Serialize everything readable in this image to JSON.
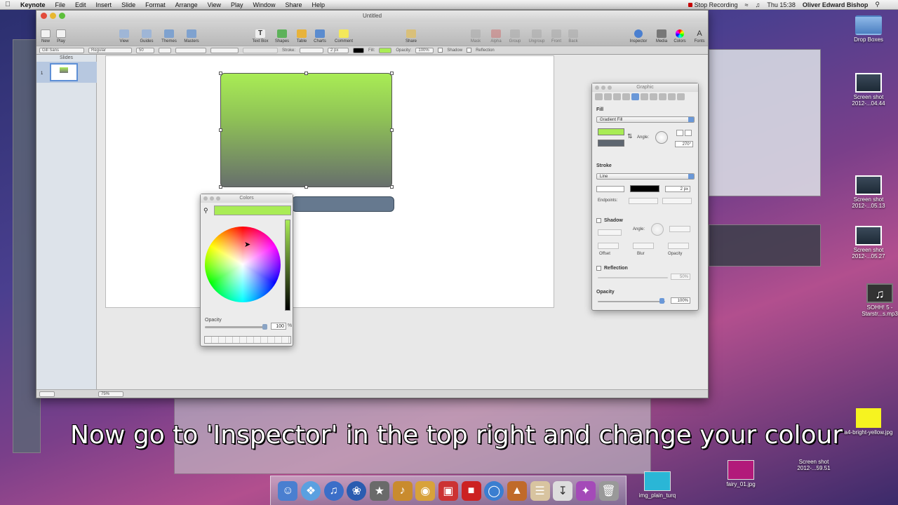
{
  "menubar": {
    "app": "Keynote",
    "menus": [
      "File",
      "Edit",
      "Insert",
      "Slide",
      "Format",
      "Arrange",
      "View",
      "Play",
      "Window",
      "Share",
      "Help"
    ],
    "recording": "Stop Recording",
    "clock": "Thu 15:38",
    "user": "Oliver Edward Bishop"
  },
  "window": {
    "title": "Untitled",
    "toolbar": {
      "left": [
        "New",
        "Play"
      ],
      "middle_left": [
        "View",
        "Guides",
        "Themes",
        "Masters"
      ],
      "middle": [
        "Text Box",
        "Shapes",
        "Table",
        "Charts",
        "Comment"
      ],
      "share": "Share",
      "right": [
        "Mask",
        "Alpha",
        "Group",
        "Ungroup",
        "Front",
        "Back"
      ],
      "far_right": [
        "Inspector",
        "Media",
        "Colors",
        "Fonts"
      ]
    },
    "formatbar": {
      "font": "Gill Sans",
      "style": "Regular",
      "size": "50",
      "stroke_label": "Stroke:",
      "stroke_width": "2 px",
      "fill_label": "Fill:",
      "opacity_label": "Opacity:",
      "opacity_value": "100%",
      "shadow_label": "Shadow",
      "reflection_label": "Reflection"
    },
    "navigator": {
      "header": "Slides",
      "slide_number": "1"
    },
    "zoom": "75%"
  },
  "colors_panel": {
    "title": "Colors",
    "current_color": "#a9ec55",
    "opacity_label": "Opacity",
    "opacity_value": "100",
    "opacity_unit": "%"
  },
  "inspector": {
    "title": "Graphic",
    "fill_section": "Fill",
    "fill_type": "Gradient Fill",
    "gradient_start": "#a9ec55",
    "gradient_end": "#5e6670",
    "angle_label": "Angle:",
    "angle_value": "270°",
    "stroke_section": "Stroke",
    "stroke_type": "Line",
    "stroke_width": "2 px",
    "endpoints_label": "Endpoints:",
    "shadow_label": "Shadow",
    "shadow_angle_label": "Angle:",
    "offset_label": "Offset",
    "blur_label": "Blur",
    "shadow_opacity_label": "Opacity",
    "reflection_label": "Reflection",
    "reflection_value": "50%",
    "opacity_section": "Opacity",
    "opacity_value": "100%"
  },
  "desktop_icons": [
    {
      "label": "Drop Boxes",
      "kind": "folder"
    },
    {
      "label": "Screen shot 2012-...04.44",
      "kind": "screenshot"
    },
    {
      "label": "Screen shot 2012-...05.13",
      "kind": "screenshot"
    },
    {
      "label": "Screen shot 2012-...05.27",
      "kind": "screenshot"
    },
    {
      "label": "SOHH! 5 - Starstr...s.mp3",
      "kind": "music"
    },
    {
      "label": "a4-bright-yellow.jpg",
      "kind": "yellow"
    },
    {
      "label": "Screen shot 2012-...59.51",
      "kind": "screenshot"
    },
    {
      "label": "fairy_01.jpg",
      "kind": "pink"
    },
    {
      "label": "img_plain_turq",
      "kind": "cyan"
    }
  ],
  "caption": "Now go to 'Inspector' in the top right and change your colour"
}
